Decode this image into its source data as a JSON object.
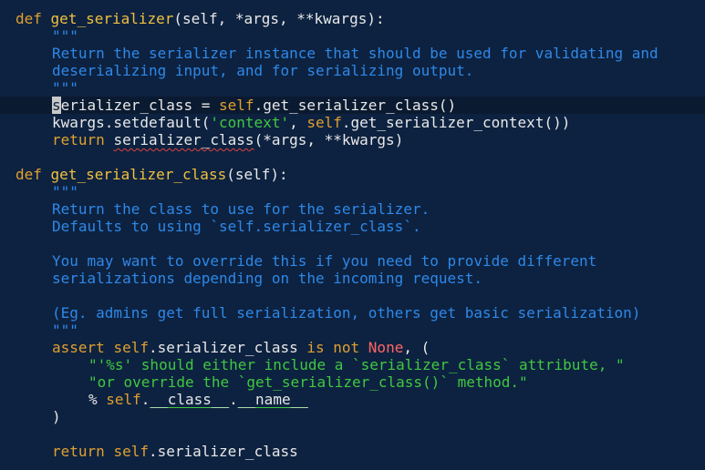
{
  "editor": {
    "language": "python",
    "colors": {
      "background": "#0d2240",
      "keyword": "#e0a030",
      "function_name": "#f0c040",
      "docstring": "#2e88e8",
      "string": "#40c840",
      "none": "#ff6464",
      "text": "#e8e8e8"
    },
    "lines": {
      "l1": {
        "kw": "def",
        "fn": "get_serializer",
        "rest": "(self, *args, **kwargs):"
      },
      "l2": {
        "doc": "\"\"\""
      },
      "l3": {
        "doc": "Return the serializer instance that should be used for validating and"
      },
      "l4": {
        "doc": "deserializing input, and for serializing output."
      },
      "l5": {
        "doc": "\"\"\""
      },
      "l7": {
        "cursor_char": "s",
        "a": "erializer_class = ",
        "self": "self",
        "b": ".get_serializer_class()"
      },
      "l8": {
        "a": "kwargs.setdefault(",
        "str": "'context'",
        "b": ", ",
        "self": "self",
        "c": ".get_serializer_context())"
      },
      "l9": {
        "kw": "return",
        "sp": " ",
        "squiggle": "serializer_class",
        "rest": "(*args, **kwargs)"
      },
      "l11": {
        "kw": "def",
        "fn": "get_serializer_class",
        "rest": "(self):"
      },
      "l12": {
        "doc": "\"\"\""
      },
      "l13": {
        "doc": "Return the class to use for the serializer."
      },
      "l14": {
        "doc": "Defaults to using `self.serializer_class`."
      },
      "l16": {
        "doc": "You may want to override this if you need to provide different"
      },
      "l17": {
        "doc": "serializations depending on the incoming request."
      },
      "l19": {
        "doc": "(Eg. admins get full serialization, others get basic serialization)"
      },
      "l20": {
        "doc": "\"\"\""
      },
      "l22": {
        "kw": "assert",
        "self": "self",
        "a": ".serializer_class ",
        "kw2": "is not",
        "none": "None",
        "b": ", ("
      },
      "l23": {
        "str": "\"'%s' should either include a `serializer_class` attribute, \""
      },
      "l24": {
        "str": "\"or override the `get_serializer_class()` method.\""
      },
      "l25": {
        "a": "% ",
        "self": "self",
        "dot1": ".",
        "d1": "__class__",
        "dot2": ".",
        "d2": "__name__"
      },
      "l26": {
        "a": ")"
      },
      "l28": {
        "kw": "return",
        "self": "self",
        "rest": ".serializer_class"
      }
    }
  }
}
